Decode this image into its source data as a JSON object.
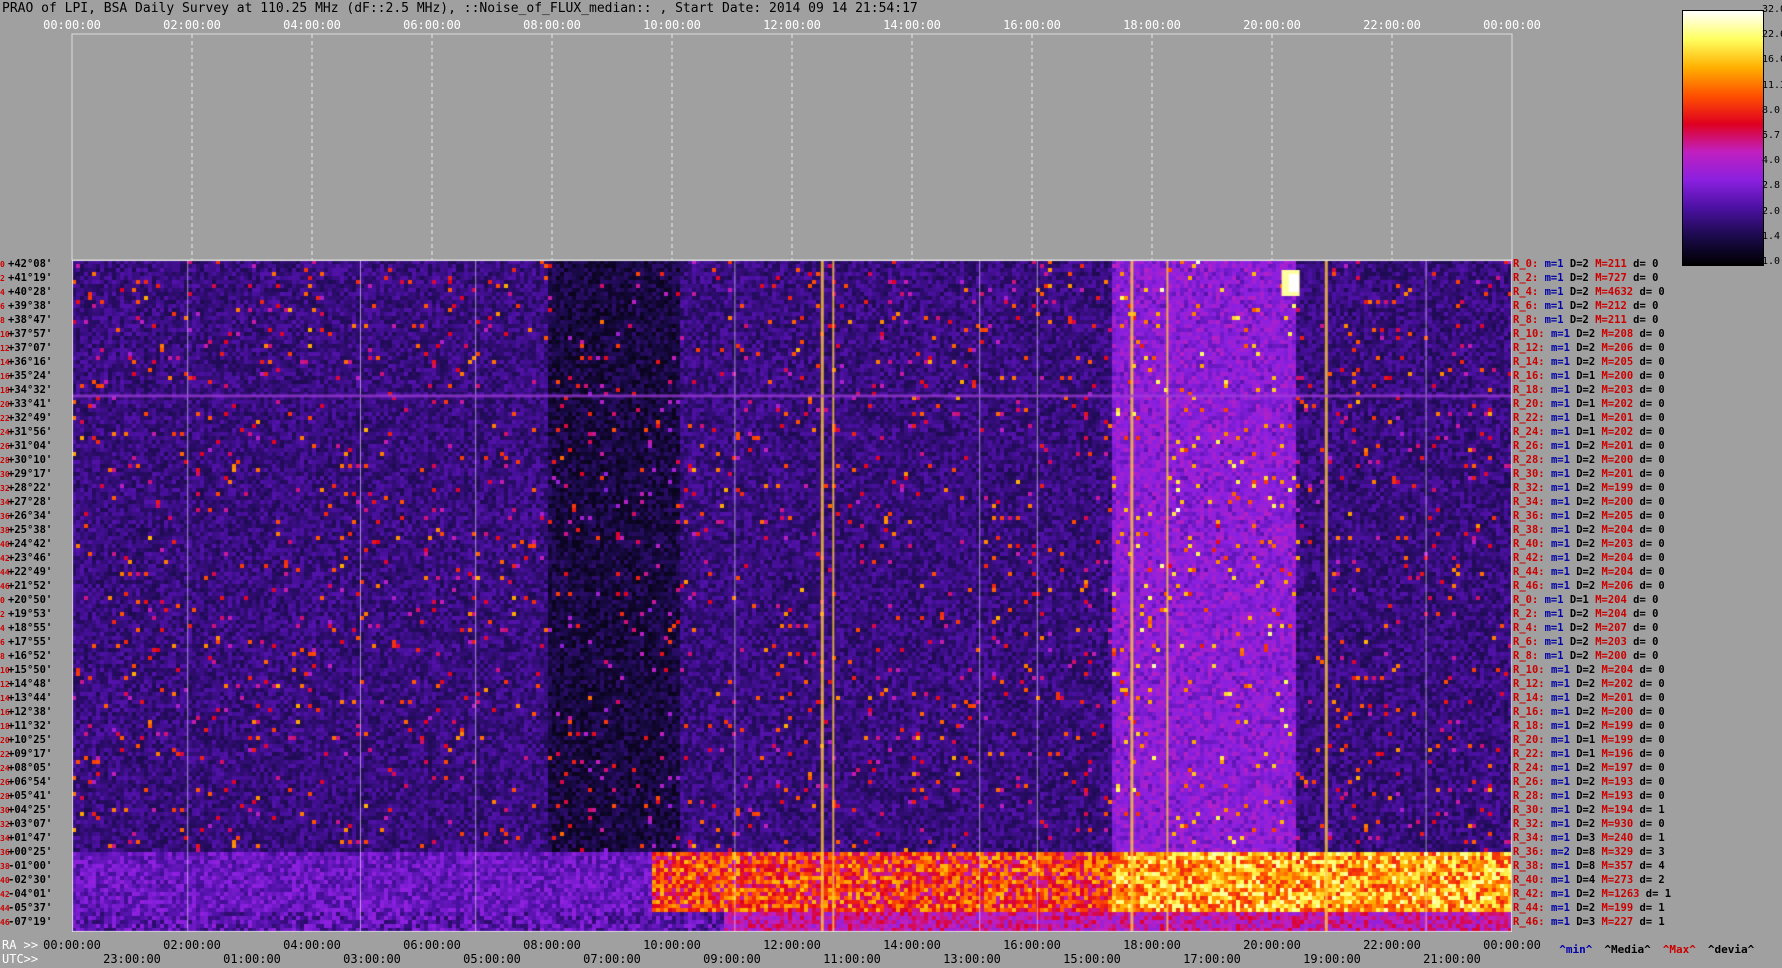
{
  "title": "PRAO of LPI, BSA Daily Survey at 110.25 MHz (dF::2.5 MHz), ::Noise_of_FLUX_median:: , Start Date: 2014 09 14 21:54:17",
  "top_ticks": [
    "00:00:00",
    "02:00:00",
    "04:00:00",
    "06:00:00",
    "08:00:00",
    "10:00:00",
    "12:00:00",
    "14:00:00",
    "16:00:00",
    "18:00:00",
    "20:00:00",
    "22:00:00",
    "00:00:00"
  ],
  "ra_label": "RA >>",
  "ra_ticks": [
    "00:00:00",
    "02:00:00",
    "04:00:00",
    "06:00:00",
    "08:00:00",
    "10:00:00",
    "12:00:00",
    "14:00:00",
    "16:00:00",
    "18:00:00",
    "20:00:00",
    "22:00:00",
    "00:00:00"
  ],
  "utc_label": "UTC>>",
  "utc_ticks": [
    "23:00:00",
    "01:00:00",
    "03:00:00",
    "05:00:00",
    "07:00:00",
    "09:00:00",
    "11:00:00",
    "13:00:00",
    "15:00:00",
    "17:00:00",
    "19:00:00",
    "21:00:00"
  ],
  "colorbar_labels": [
    "32.0",
    "22.6",
    "16.0",
    "11.3",
    "8.0",
    "5.7",
    "4.0",
    "2.8",
    "2.0",
    "1.4",
    "1.0"
  ],
  "colorbar_colors": [
    "#000000",
    "#1a0a4a",
    "#4a10a0",
    "#8a20e0",
    "#c020c0",
    "#e00020",
    "#ff5000",
    "#ffb000",
    "#ffff60",
    "#ffffff"
  ],
  "legend": {
    "min": "^min^",
    "median": "^Media^",
    "max": "^Max^",
    "dev": "^devia^"
  },
  "chart_data": {
    "type": "heatmap",
    "title": "PRAO of LPI, BSA Daily Survey at 110.25 MHz (dF::2.5 MHz), ::Noise_of_FLUX_median:: , Start Date: 2014 09 14 21:54:17",
    "x_axis": "RA / UTC",
    "color_scale": [
      1.0,
      32.0
    ],
    "declinations": [
      "+42°08'",
      "+41°19'",
      "+40°28'",
      "+39°38'",
      "+38°47'",
      "+37°57'",
      "+37°07'",
      "+36°16'",
      "+35°24'",
      "+34°32'",
      "+33°41'",
      "+32°49'",
      "+31°56'",
      "+31°04'",
      "+30°10'",
      "+29°17'",
      "+28°22'",
      "+27°28'",
      "+26°34'",
      "+25°38'",
      "+24°42'",
      "+23°46'",
      "+22°49'",
      "+21°52'",
      "+20°50'",
      "+19°53'",
      "+18°55'",
      "+17°55'",
      "+16°52'",
      "+15°50'",
      "+14°48'",
      "+13°44'",
      "+12°38'",
      "+11°32'",
      "+10°25'",
      "+09°17'",
      "+08°05'",
      "+06°54'",
      "+05°41'",
      "+04°25'",
      "+03°07'",
      "+01°47'",
      "+00°25'",
      "-01°00'",
      "-02°30'",
      "-04°01'",
      "-05°37'",
      "-07°19'"
    ],
    "row_numbers": [
      "0",
      "2",
      "4",
      "6",
      "8",
      "10",
      "12",
      "14",
      "16",
      "18",
      "20",
      "22",
      "24",
      "26",
      "28",
      "30",
      "32",
      "34",
      "36",
      "38",
      "40",
      "42",
      "44",
      "46",
      "0",
      "2",
      "4",
      "6",
      "8",
      "10",
      "12",
      "14",
      "16",
      "18",
      "20",
      "22",
      "24",
      "26",
      "28",
      "30",
      "32",
      "34",
      "36",
      "38",
      "40",
      "42",
      "44",
      "46"
    ],
    "row_stats": [
      {
        "r": "R_0:",
        "m": "m=1",
        "D": "D=2",
        "M": "M=211",
        "d": "d= 0"
      },
      {
        "r": "R_2:",
        "m": "m=1",
        "D": "D=2",
        "M": "M=727",
        "d": "d= 0"
      },
      {
        "r": "R_4:",
        "m": "m=1",
        "D": "D=2",
        "M": "M=4632",
        "d": "d= 0"
      },
      {
        "r": "R_6:",
        "m": "m=1",
        "D": "D=2",
        "M": "M=212",
        "d": "d= 0"
      },
      {
        "r": "R_8:",
        "m": "m=1",
        "D": "D=2",
        "M": "M=211",
        "d": "d= 0"
      },
      {
        "r": "R_10:",
        "m": "m=1",
        "D": "D=2",
        "M": "M=208",
        "d": "d= 0"
      },
      {
        "r": "R_12:",
        "m": "m=1",
        "D": "D=2",
        "M": "M=206",
        "d": "d= 0"
      },
      {
        "r": "R_14:",
        "m": "m=1",
        "D": "D=2",
        "M": "M=205",
        "d": "d= 0"
      },
      {
        "r": "R_16:",
        "m": "m=1",
        "D": "D=1",
        "M": "M=200",
        "d": "d= 0"
      },
      {
        "r": "R_18:",
        "m": "m=1",
        "D": "D=2",
        "M": "M=203",
        "d": "d= 0"
      },
      {
        "r": "R_20:",
        "m": "m=1",
        "D": "D=1",
        "M": "M=202",
        "d": "d= 0"
      },
      {
        "r": "R_22:",
        "m": "m=1",
        "D": "D=1",
        "M": "M=201",
        "d": "d= 0"
      },
      {
        "r": "R_24:",
        "m": "m=1",
        "D": "D=1",
        "M": "M=202",
        "d": "d= 0"
      },
      {
        "r": "R_26:",
        "m": "m=1",
        "D": "D=2",
        "M": "M=201",
        "d": "d= 0"
      },
      {
        "r": "R_28:",
        "m": "m=1",
        "D": "D=2",
        "M": "M=200",
        "d": "d= 0"
      },
      {
        "r": "R_30:",
        "m": "m=1",
        "D": "D=2",
        "M": "M=201",
        "d": "d= 0"
      },
      {
        "r": "R_32:",
        "m": "m=1",
        "D": "D=2",
        "M": "M=199",
        "d": "d= 0"
      },
      {
        "r": "R_34:",
        "m": "m=1",
        "D": "D=2",
        "M": "M=200",
        "d": "d= 0"
      },
      {
        "r": "R_36:",
        "m": "m=1",
        "D": "D=2",
        "M": "M=205",
        "d": "d= 0"
      },
      {
        "r": "R_38:",
        "m": "m=1",
        "D": "D=2",
        "M": "M=204",
        "d": "d= 0"
      },
      {
        "r": "R_40:",
        "m": "m=1",
        "D": "D=2",
        "M": "M=203",
        "d": "d= 0"
      },
      {
        "r": "R_42:",
        "m": "m=1",
        "D": "D=2",
        "M": "M=204",
        "d": "d= 0"
      },
      {
        "r": "R_44:",
        "m": "m=1",
        "D": "D=2",
        "M": "M=204",
        "d": "d= 0"
      },
      {
        "r": "R_46:",
        "m": "m=1",
        "D": "D=2",
        "M": "M=206",
        "d": "d= 0"
      },
      {
        "r": "R_0:",
        "m": "m=1",
        "D": "D=1",
        "M": "M=204",
        "d": "d= 0"
      },
      {
        "r": "R_2:",
        "m": "m=1",
        "D": "D=2",
        "M": "M=204",
        "d": "d= 0"
      },
      {
        "r": "R_4:",
        "m": "m=1",
        "D": "D=2",
        "M": "M=207",
        "d": "d= 0"
      },
      {
        "r": "R_6:",
        "m": "m=1",
        "D": "D=2",
        "M": "M=203",
        "d": "d= 0"
      },
      {
        "r": "R_8:",
        "m": "m=1",
        "D": "D=2",
        "M": "M=200",
        "d": "d= 0"
      },
      {
        "r": "R_10:",
        "m": "m=1",
        "D": "D=2",
        "M": "M=204",
        "d": "d= 0"
      },
      {
        "r": "R_12:",
        "m": "m=1",
        "D": "D=2",
        "M": "M=202",
        "d": "d= 0"
      },
      {
        "r": "R_14:",
        "m": "m=1",
        "D": "D=2",
        "M": "M=201",
        "d": "d= 0"
      },
      {
        "r": "R_16:",
        "m": "m=1",
        "D": "D=2",
        "M": "M=200",
        "d": "d= 0"
      },
      {
        "r": "R_18:",
        "m": "m=1",
        "D": "D=2",
        "M": "M=199",
        "d": "d= 0"
      },
      {
        "r": "R_20:",
        "m": "m=1",
        "D": "D=1",
        "M": "M=199",
        "d": "d= 0"
      },
      {
        "r": "R_22:",
        "m": "m=1",
        "D": "D=1",
        "M": "M=196",
        "d": "d= 0"
      },
      {
        "r": "R_24:",
        "m": "m=1",
        "D": "D=2",
        "M": "M=197",
        "d": "d= 0"
      },
      {
        "r": "R_26:",
        "m": "m=1",
        "D": "D=2",
        "M": "M=193",
        "d": "d= 0"
      },
      {
        "r": "R_28:",
        "m": "m=1",
        "D": "D=2",
        "M": "M=193",
        "d": "d= 0"
      },
      {
        "r": "R_30:",
        "m": "m=1",
        "D": "D=2",
        "M": "M=194",
        "d": "d= 1"
      },
      {
        "r": "R_32:",
        "m": "m=1",
        "D": "D=2",
        "M": "M=930",
        "d": "d= 0"
      },
      {
        "r": "R_34:",
        "m": "m=1",
        "D": "D=3",
        "M": "M=240",
        "d": "d= 1"
      },
      {
        "r": "R_36:",
        "m": "m=2",
        "D": "D=8",
        "M": "M=329",
        "d": "d= 3"
      },
      {
        "r": "R_38:",
        "m": "m=1",
        "D": "D=8",
        "M": "M=357",
        "d": "d= 4"
      },
      {
        "r": "R_40:",
        "m": "m=1",
        "D": "D=4",
        "M": "M=273",
        "d": "d= 2"
      },
      {
        "r": "R_42:",
        "m": "m=1",
        "D": "D=2",
        "M": "M=1263",
        "d": "d= 1"
      },
      {
        "r": "R_44:",
        "m": "m=1",
        "D": "D=2",
        "M": "M=199",
        "d": "d= 1"
      },
      {
        "r": "R_46:",
        "m": "m=1",
        "D": "D=3",
        "M": "M=227",
        "d": "d= 1"
      }
    ]
  }
}
